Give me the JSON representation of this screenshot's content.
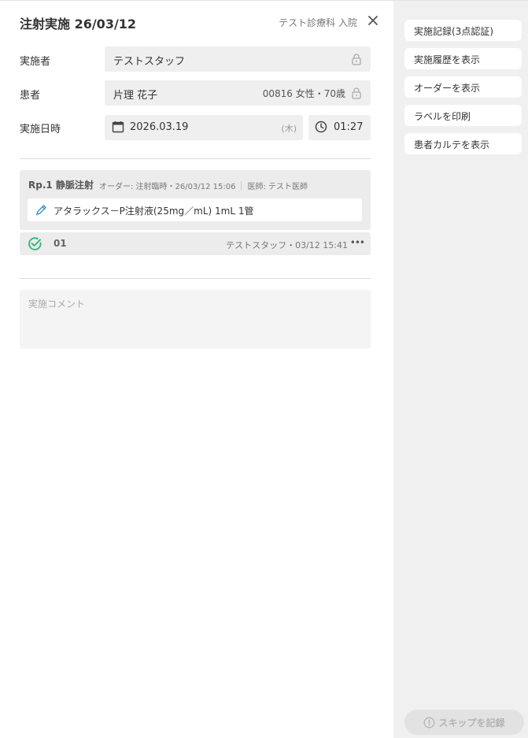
{
  "header": {
    "title": "注射実施 26/03/12",
    "department": "テスト診療科 入院",
    "close_icon": "close-icon"
  },
  "performer": {
    "label": "実施者",
    "value": "テストスタッフ"
  },
  "patient": {
    "label": "患者",
    "name": "片理 花子",
    "info": "00816 女性・70歳"
  },
  "datetime": {
    "label": "実施日時",
    "date": "2026.03.19",
    "weekday": "(木)",
    "time": "01:27"
  },
  "rp": {
    "title": "Rp.1 静脈注射",
    "order": "オーダー: 注射臨時・26/03/12 15:06",
    "doctor": "医師: テスト医師",
    "drug": "アタラックス－P注射液(25mg／mL) 1mL  1管"
  },
  "status": {
    "number": "01",
    "by": "テストスタッフ・03/12 15:41",
    "more": "•••"
  },
  "comment": {
    "placeholder": "実施コメント"
  },
  "sidebar": {
    "buttons": [
      {
        "label": "実施記録(3点認証)"
      },
      {
        "label": "実施履歴を表示"
      },
      {
        "label": "オーダーを表示"
      },
      {
        "label": "ラベルを印刷"
      },
      {
        "label": "患者カルテを表示"
      }
    ],
    "skip_label": "スキップを記録"
  },
  "colors": {
    "accent_check": "#2bb673",
    "pen_icon": "#2a8fd0",
    "sidebar_bg": "#f0f0f0"
  }
}
